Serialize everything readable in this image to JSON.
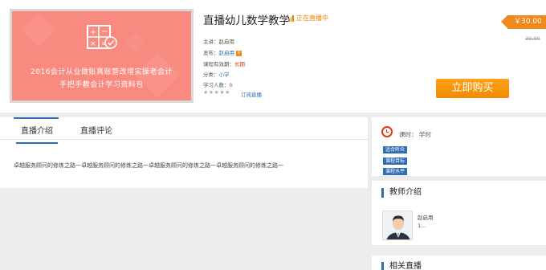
{
  "course": {
    "title": "直播幼儿数学教学",
    "live_status": "正在直播中",
    "cover_line1": "2016会计从业做账真账营改增实操老会计",
    "cover_line2": "手把手教会计学习资料包",
    "lecturer_label": "主讲：",
    "lecturer": "赵启用",
    "publisher_label": "发布：",
    "publisher": "赵启用",
    "publisher_tag": "V",
    "validity_label": "课程有效期：",
    "validity": "长期",
    "category_label": "分类：",
    "category": "小学",
    "students_label": "学习人数：",
    "students": "0",
    "stars": "★★★★★",
    "subscribe_label": "订阅直播",
    "price": "￥30.00",
    "old_price": "30.00",
    "buy_label": "立即购买"
  },
  "tabs": [
    {
      "label": "直播介绍"
    },
    {
      "label": "直播评论"
    }
  ],
  "description": "卓越服务顾问的修炼之路一卓越服务顾问的修炼之路一卓越服务顾问的修炼之路一卓越服务顾问的修炼之路一",
  "sidebar": {
    "class_time": "课时：  学时",
    "badges": [
      "适合听众",
      "课程目标",
      "课程水平"
    ],
    "teacher_heading": "教师介绍",
    "teacher_name": "赵启用",
    "teacher_intro": "1...",
    "related_heading": "相关直播"
  },
  "colors": {
    "accent": "#2f6db5",
    "price_orange": "#f08a1c",
    "cover_bg": "#f98a80",
    "red": "#e8380d"
  }
}
